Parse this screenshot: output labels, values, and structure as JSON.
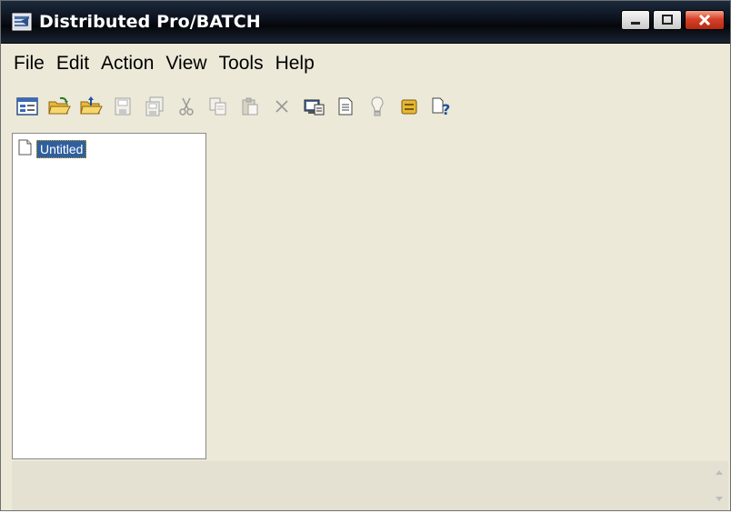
{
  "window": {
    "title": "Distributed Pro/BATCH",
    "controls": [
      "minimize",
      "maximize",
      "close"
    ]
  },
  "menu": {
    "items": [
      "File",
      "Edit",
      "Action",
      "View",
      "Tools",
      "Help"
    ]
  },
  "toolbar": {
    "icons": [
      "properties-icon",
      "open-folder-icon",
      "open-folder-up-icon",
      "save-icon",
      "save-as-icon",
      "cut-icon",
      "copy-icon",
      "paste-icon",
      "delete-icon",
      "computer-properties-icon",
      "document-icon",
      "lightbulb-icon",
      "database-icon",
      "help-icon"
    ]
  },
  "tree": {
    "items": [
      {
        "label": "Untitled",
        "icon": "document-icon",
        "selected": true
      }
    ]
  },
  "colors": {
    "window_bg": "#ece9d8",
    "titlebar": "#0d1420",
    "selection": "#2f5f9f",
    "close_button": "#d7412a"
  }
}
